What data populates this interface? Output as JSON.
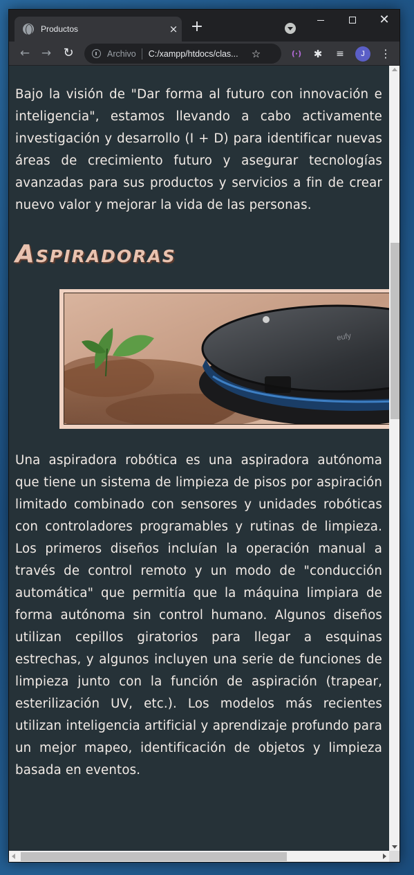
{
  "browser": {
    "tab_title": "Productos",
    "tab_close": "×",
    "new_tab": "+",
    "address_prefix": "Archivo",
    "url": "C:/xampp/htdocs/clas...",
    "profile_initial": "J"
  },
  "page": {
    "intro_paragraph": "Bajo la visión de \"Dar forma al futuro con innovación e inteligencia\", estamos llevando a cabo activamente investigación y desarrollo (I + D) para identificar nuevas áreas de crecimiento futuro y asegurar tecnologías avanzadas para sus productos y servicios a fin de crear nuevo valor y mejorar la vida de las personas.",
    "section_heading": "Aspiradoras",
    "section_paragraph": "Una aspiradora robótica es una aspiradora autónoma que tiene un sistema de limpieza de pisos por aspiración limitado combinado con sensores y unidades robóticas con controladores programables y rutinas de limpieza. Los primeros diseños incluían la operación manual a través de control remoto y un modo de \"conducción automática\" que permitía que la máquina limpiara de forma autónoma sin control humano. Algunos diseños utilizan cepillos giratorios para llegar a esquinas estrechas, y algunos incluyen una serie de funciones de limpieza junto con la función de aspiración (trapear, esterilización UV, etc.). Los modelos más recientes utilizan inteligencia artificial y aprendizaje profundo para un mejor mapeo, identificación de objetos y limpieza basada en eventos."
  },
  "colors": {
    "page_background": "#263238",
    "text": "#f2ebe6",
    "heading": "#e9c3b0",
    "image_frame": "#f0d2c2"
  },
  "icons": [
    "globe-icon",
    "close-icon",
    "plus-icon",
    "tab-search-icon",
    "minimize-icon",
    "maximize-icon",
    "back-arrow-icon",
    "forward-arrow-icon",
    "reload-icon",
    "info-icon",
    "star-icon",
    "extension-icon",
    "puzzle-icon",
    "media-control-icon",
    "kebab-menu-icon"
  ]
}
